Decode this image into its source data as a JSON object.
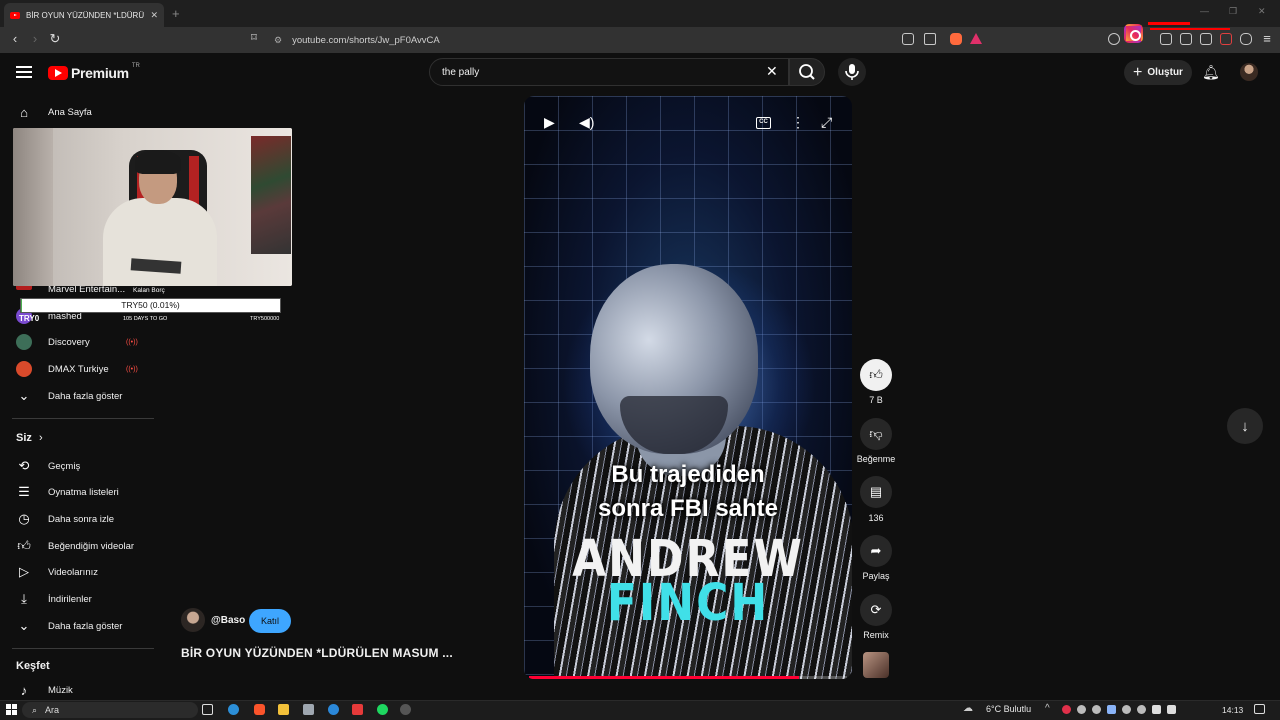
{
  "browser": {
    "tab_title": "BİR OYUN YÜZÜNDEN *LDÜRÜLEN MASUM ...",
    "url": "youtube.com/shorts/Jw_pF0AvvCA"
  },
  "header": {
    "logo_text": "Premium",
    "logo_region": "TR",
    "search_value": "the pally",
    "create_label": "Oluştur"
  },
  "sidebar": {
    "home_label": "Ana Sayfa",
    "subscriptions": [
      {
        "name": "Marvel Entertain...",
        "color": "#b31d1d"
      },
      {
        "name": "mashed",
        "color": "#7a4bd0"
      },
      {
        "name": "Discovery",
        "color": "#3d6e58",
        "live": "((•))"
      },
      {
        "name": "DMAX Turkiye",
        "color": "#d94a2b",
        "live": "((•))"
      }
    ],
    "show_more_1": "Daha fazla göster",
    "you_heading": "Siz",
    "you_items": [
      {
        "label": "Geçmiş",
        "icon": "history-icon"
      },
      {
        "label": "Oynatma listeleri",
        "icon": "playlists-icon"
      },
      {
        "label": "Daha sonra izle",
        "icon": "watch-later-icon"
      },
      {
        "label": "Beğendiğim videolar",
        "icon": "liked-videos-icon"
      },
      {
        "label": "Videolarınız",
        "icon": "your-videos-icon"
      },
      {
        "label": "İndirilenler",
        "icon": "downloads-icon"
      }
    ],
    "show_more_2": "Daha fazla göster",
    "explore_heading": "Keşfet",
    "explore_items": [
      {
        "label": "Müzik",
        "icon": "music-icon"
      }
    ]
  },
  "donation_overlay": {
    "label": "Kalan Borç",
    "bar_text": "TRY50 (0.01%)",
    "progress_percent": 0.01,
    "start_text": "TRY0",
    "days_text": "105 DAYS TO GO",
    "goal_text": "TRY500000"
  },
  "player": {
    "caption_line1": "Bu trajediden",
    "caption_line2": "sonra FBI sahte",
    "name_line1": "ANDREW",
    "name_line2": "FINCH",
    "cc_label": "CC",
    "progress_fraction": 0.85
  },
  "actions": {
    "like_count": "7 B",
    "dislike_label": "Beğenme",
    "comment_count": "136",
    "share_label": "Paylaş",
    "remix_label": "Remix"
  },
  "channel": {
    "handle": "@Baso",
    "join_label": "Katıl",
    "short_title": "BİR OYUN YÜZÜNDEN *LDÜRÜLEN MASUM ..."
  },
  "taskbar": {
    "search_placeholder": "Ara",
    "weather": "6°C  Bulutlu",
    "time": "14:13"
  },
  "colors": {
    "accent_red": "#ff0000",
    "join_blue": "#3ea6ff",
    "name_cyan": "#40e0e8"
  }
}
